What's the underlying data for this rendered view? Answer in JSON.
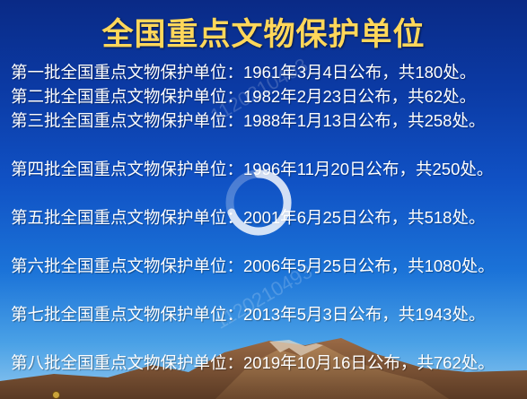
{
  "slide": {
    "title": "全国重点文物保护单位",
    "batches": [
      {
        "label": "第一批全国重点文物保护单位：",
        "year": "1961",
        "month": "3",
        "day": "4",
        "count": "180",
        "tail": "处。"
      },
      {
        "label": "第二批全国重点文物保护单位：",
        "year": "1982",
        "month": "2",
        "day": "23",
        "count": "62",
        "tail": "处。"
      },
      {
        "label": "第三批全国重点文物保护单位：",
        "year": "1988",
        "month": "1",
        "day": "13",
        "count": "258",
        "tail": "处。"
      },
      {
        "label": "第四批全国重点文物保护单位：",
        "year": "1996",
        "month": "11",
        "day": "20",
        "count": "250",
        "tail": "处。"
      },
      {
        "label": "第五批全国重点文物保护单位：",
        "year": "2001",
        "month": "6",
        "day": "25",
        "count": "518",
        "tail": "处。"
      },
      {
        "label": "第六批全国重点文物保护单位：",
        "year": "2006",
        "month": "5",
        "day": "25",
        "count": "1080",
        "tail": "处。"
      },
      {
        "label": "第七批全国重点文物保护单位：",
        "year": "2013",
        "month": "5",
        "day": "3",
        "count": "1943",
        "tail": "处。"
      },
      {
        "label": "第八批全国重点文物保护单位：",
        "year": "2019",
        "month": "10",
        "day": "16",
        "count": "762",
        "tail": "处。"
      }
    ],
    "watermark": "1120210493"
  },
  "colors": {
    "title": "#ffd75a",
    "text": "#ffffff",
    "sky_top": "#0a2a86",
    "sky_bottom": "#8fc7ef",
    "mountain": "#8a5a3a",
    "spinner": "#ffffff"
  },
  "icons": [
    "loading-spinner-icon",
    "corner-marker-icon"
  ]
}
